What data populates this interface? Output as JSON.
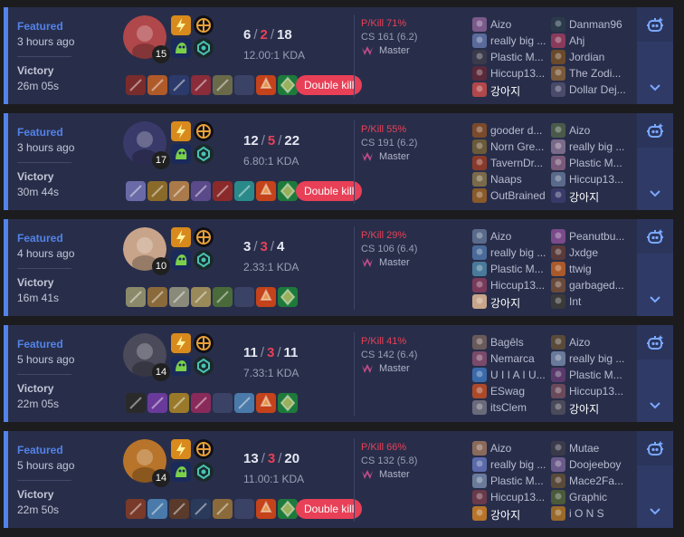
{
  "matches": [
    {
      "queue": "Featured",
      "time_ago": "3 hours ago",
      "result": "Victory",
      "duration": "26m 05s",
      "champion_color": "#b0474a",
      "level": "15",
      "kills": "6",
      "deaths": "2",
      "assists": "18",
      "kda": "12.00:1 KDA",
      "multikill": "Double kill",
      "pkill": "P/Kill 71%",
      "cs": "CS 161 (6.2)",
      "tier": "Master",
      "items": [
        "#7a2c2c",
        "#b05a2a",
        "#2c3a6b",
        "#8a2c3a",
        "#6a6a4a",
        "",
        "#c4431a",
        "#1e7a3a"
      ],
      "team1": [
        {
          "name": "Aizo",
          "color": "#7a5a8a"
        },
        {
          "name": "really big ...",
          "color": "#5a6a9a"
        },
        {
          "name": "Plastic M...",
          "color": "#3a3a4a"
        },
        {
          "name": "Hiccup13...",
          "color": "#5a2a3a"
        },
        {
          "name": "강아지",
          "color": "#b0474a",
          "me": true
        }
      ],
      "team2": [
        {
          "name": "Danman96",
          "color": "#2a3a4a"
        },
        {
          "name": "Ahj",
          "color": "#8a3a5a"
        },
        {
          "name": "Jordian",
          "color": "#6a4a2a"
        },
        {
          "name": "The Zodi...",
          "color": "#7a5a3a"
        },
        {
          "name": "Dollar Dej...",
          "color": "#4a4a6a"
        }
      ]
    },
    {
      "queue": "Featured",
      "time_ago": "3 hours ago",
      "result": "Victory",
      "duration": "30m 44s",
      "champion_color": "#3a3a6a",
      "level": "17",
      "kills": "12",
      "deaths": "5",
      "assists": "22",
      "kda": "6.80:1 KDA",
      "multikill": "Double kill",
      "pkill": "P/Kill 55%",
      "cs": "CS 191 (6.2)",
      "tier": "Master",
      "items": [
        "#6a6aa8",
        "#8a6a2a",
        "#aa7a4a",
        "#5a4a8a",
        "#8a2a2a",
        "#2a8a8a",
        "#c4431a",
        "#1e7a3a"
      ],
      "team1": [
        {
          "name": "gooder d...",
          "color": "#7a4a2a"
        },
        {
          "name": "Norn Gre...",
          "color": "#6a5a3a"
        },
        {
          "name": "TavernDr...",
          "color": "#8a3a2a"
        },
        {
          "name": "Naaps",
          "color": "#7a6a4a"
        },
        {
          "name": "OutBrained",
          "color": "#8a5a2a"
        }
      ],
      "team2": [
        {
          "name": "Aizo",
          "color": "#4a5a4a"
        },
        {
          "name": "really big ...",
          "color": "#7a6a8a"
        },
        {
          "name": "Plastic M...",
          "color": "#7a5a7a"
        },
        {
          "name": "Hiccup13...",
          "color": "#5a6a8a"
        },
        {
          "name": "강아지",
          "color": "#3a3a6a",
          "me": true
        }
      ]
    },
    {
      "queue": "Featured",
      "time_ago": "4 hours ago",
      "result": "Victory",
      "duration": "16m 41s",
      "champion_color": "#c8a48a",
      "level": "10",
      "kills": "3",
      "deaths": "3",
      "assists": "4",
      "kda": "2.33:1 KDA",
      "multikill": "",
      "pkill": "P/Kill 29%",
      "cs": "CS 106 (6.4)",
      "tier": "Master",
      "items": [
        "#8a8a6a",
        "#8a6a3a",
        "#8a8a7a",
        "#9a8a5a",
        "#4a6a3a",
        "",
        "#c4431a",
        "#1e7a3a"
      ],
      "team1": [
        {
          "name": "Aizo",
          "color": "#5a6a8a"
        },
        {
          "name": "really big ...",
          "color": "#4a6a9a"
        },
        {
          "name": "Plastic M...",
          "color": "#4a7a9a"
        },
        {
          "name": "Hiccup13...",
          "color": "#7a3a5a"
        },
        {
          "name": "강아지",
          "color": "#c8a48a",
          "me": true
        }
      ],
      "team2": [
        {
          "name": "Peanutbu...",
          "color": "#7a4a8a"
        },
        {
          "name": "Jxdge",
          "color": "#5a3a3a"
        },
        {
          "name": "ttwig",
          "color": "#aa5a2a"
        },
        {
          "name": "garbaged...",
          "color": "#6a4a3a"
        },
        {
          "name": "Int",
          "color": "#3a3a3a"
        }
      ]
    },
    {
      "queue": "Featured",
      "time_ago": "5 hours ago",
      "result": "Victory",
      "duration": "22m 05s",
      "champion_color": "#4a4a5a",
      "level": "14",
      "kills": "11",
      "deaths": "3",
      "assists": "11",
      "kda": "7.33:1 KDA",
      "multikill": "",
      "pkill": "P/Kill 41%",
      "cs": "CS 142 (6.4)",
      "tier": "Master",
      "items": [
        "#2a2a2a",
        "#6a3a9a",
        "#9a7a2a",
        "#8a2a5a",
        "",
        "#4a7aaa",
        "#c4431a",
        "#1e7a3a"
      ],
      "team1": [
        {
          "name": "Bagêls",
          "color": "#6a5a5a"
        },
        {
          "name": "Nemarca",
          "color": "#7a4a6a"
        },
        {
          "name": "U I I A I U...",
          "color": "#3a6aaa"
        },
        {
          "name": "ESwag",
          "color": "#aa4a2a"
        },
        {
          "name": "itsClem",
          "color": "#6a6a7a"
        }
      ],
      "team2": [
        {
          "name": "Aizo",
          "color": "#5a4a3a"
        },
        {
          "name": "really big ...",
          "color": "#6a7a9a"
        },
        {
          "name": "Plastic M...",
          "color": "#5a3a6a"
        },
        {
          "name": "Hiccup13...",
          "color": "#6a4a5a"
        },
        {
          "name": "강아지",
          "color": "#4a4a5a",
          "me": true
        }
      ]
    },
    {
      "queue": "Featured",
      "time_ago": "5 hours ago",
      "result": "Victory",
      "duration": "22m 50s",
      "champion_color": "#b8742a",
      "level": "14",
      "kills": "13",
      "deaths": "3",
      "assists": "20",
      "kda": "11.00:1 KDA",
      "multikill": "Double kill",
      "pkill": "P/Kill 66%",
      "cs": "CS 132 (5.8)",
      "tier": "Master",
      "items": [
        "#7a3a2a",
        "#4a7aaa",
        "#5a3a2a",
        "#2a3a5a",
        "#8a6a3a",
        "",
        "#c4431a",
        "#1e7a3a"
      ],
      "team1": [
        {
          "name": "Aizo",
          "color": "#8a6a5a"
        },
        {
          "name": "really big ...",
          "color": "#5a6aaa"
        },
        {
          "name": "Plastic M...",
          "color": "#6a7a9a"
        },
        {
          "name": "Hiccup13...",
          "color": "#6a3a4a"
        },
        {
          "name": "강아지",
          "color": "#b8742a",
          "me": true
        }
      ],
      "team2": [
        {
          "name": "Mutae",
          "color": "#3a3a4a"
        },
        {
          "name": "Doojeeboy",
          "color": "#6a5a8a"
        },
        {
          "name": "Mace2Fa...",
          "color": "#5a4a3a"
        },
        {
          "name": "Graphic",
          "color": "#4a5a3a"
        },
        {
          "name": "i O N S",
          "color": "#9a6a2a"
        }
      ]
    }
  ],
  "colors": {
    "accent": "#5383e8",
    "loss": "#e84057",
    "card": "#282e4a"
  },
  "icons": {
    "spell_1": "flash-icon",
    "spell_2": "ghost-icon",
    "rune_primary": "conqueror-rune-icon",
    "rune_secondary": "resolve-rune-icon",
    "tier": "master-tier-icon",
    "ai": "ai-assistant-icon",
    "expand": "chevron-down-icon"
  }
}
